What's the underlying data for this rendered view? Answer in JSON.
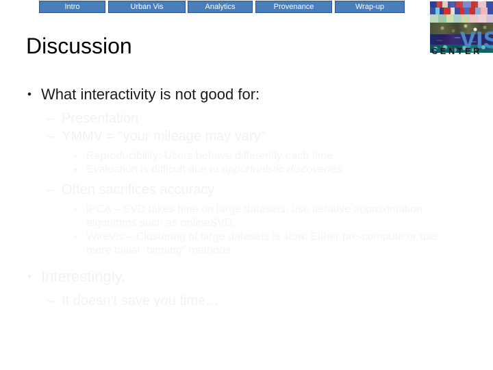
{
  "nav": {
    "items": [
      {
        "label": "Intro"
      },
      {
        "label": "Urban Vis"
      },
      {
        "label": "Analytics"
      },
      {
        "label": "Provenance"
      },
      {
        "label": "Wrap-up"
      }
    ]
  },
  "logo": {
    "name": "vis-center-logo",
    "vis_text": "VIS",
    "center_text": "CENTER"
  },
  "slide": {
    "title": "Discussion",
    "bullets": {
      "b1": "What interactivity is not good for:",
      "b1_1": "Presentation",
      "b1_2": "YMMV = “your mileage may vary”",
      "b1_2_1": "Reproducibility:  Users behave differently each time.",
      "b1_2_2_pre": "Evaluation is difficult due to ",
      "b1_2_2_em": "opportunistic discoveries",
      "b1_2_2_post": "..",
      "b1_3": "Often sacrifices accuracy",
      "b1_3_1": "iPCA – SVD takes time on large datasets, use iterative approximation algorithms such as onlineSVD.",
      "b1_3_2": "WireVis – Clustering of large datasets is slow.  Either pre-compute or use more trivial “binning” methods.",
      "b2": "Interestingly,",
      "b2_1": "It doesn’t save you time…"
    },
    "marks": {
      "dot": "•",
      "dash": "–"
    }
  },
  "colors": {
    "nav_fill": "#4a7ebb",
    "nav_border": "#31538a",
    "nav_text": "#ffffff",
    "title_text": "#000000",
    "body_text": "#1a1a1a",
    "ghost_text": "#f2f2f2",
    "logo_vis": "#4a86c8"
  }
}
